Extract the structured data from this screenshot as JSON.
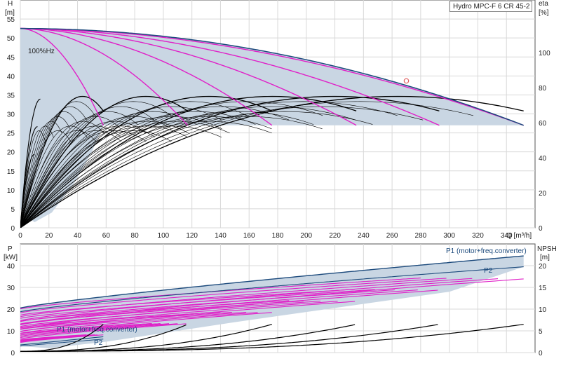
{
  "chart_data": [
    {
      "type": "line",
      "title": "Hydro MPC-F 6 CR 45-2",
      "xlabel": "Q [m³/h]",
      "ylabel_left": [
        "H",
        "[m]"
      ],
      "ylabel_right": [
        "eta",
        "[%]"
      ],
      "annotation": "100%Hz",
      "xlim": [
        0,
        360
      ],
      "x_ticks": [
        0,
        20,
        40,
        60,
        80,
        100,
        120,
        140,
        160,
        180,
        200,
        220,
        240,
        260,
        280,
        300,
        320,
        340
      ],
      "ylim_left": [
        0,
        60
      ],
      "y_ticks_left": [
        0,
        5,
        10,
        15,
        20,
        25,
        30,
        35,
        40,
        45,
        50,
        55
      ],
      "ylim_right": [
        0,
        130
      ],
      "y_ticks_right": [
        0,
        20,
        40,
        60,
        80,
        100
      ],
      "operating_range_shade": "#c9d6e3",
      "pump_curves_H": {
        "n_pumps": [
          1,
          2,
          3,
          4,
          5,
          6
        ],
        "qmax": [
          58,
          117,
          176,
          235,
          293,
          352
        ],
        "H0": 52.5,
        "Hend_100": 27,
        "min_head": 27,
        "color_100": "#1c4a7c",
        "color_reduced": "#e020c8"
      },
      "duty_point": {
        "x": 270,
        "y": 38.7,
        "color": "#e06060"
      },
      "efficiency_curves": {
        "color": "#000000",
        "peak_eta_full": 70,
        "best_eff_fraction": 0.6,
        "n_pumps": [
          1,
          2,
          3,
          4,
          5,
          6
        ]
      }
    },
    {
      "type": "line",
      "ylabel_left": [
        "P",
        "[kW]"
      ],
      "ylabel_right": [
        "NPSH",
        "[m]"
      ],
      "xlim": [
        0,
        360
      ],
      "ylim_left": [
        0,
        50
      ],
      "y_ticks_left": [
        0,
        10,
        20,
        30,
        40
      ],
      "ylim_right": [
        0,
        25
      ],
      "y_ticks_right": [
        0,
        5,
        10,
        15,
        20
      ],
      "labels": {
        "p1_top": "P1 (motor+freq.converter)",
        "p2_top": "P2",
        "p1_low": "P1 (motor+freq.converter)",
        "p2_low": "P2"
      },
      "power": {
        "p1_at_zero": 20.5,
        "p1_at_max": 44.5,
        "p2_at_max": 39.5,
        "p2_offset": 1.7,
        "color_100": "#1c4a7c",
        "color_reduced": "#e020c8"
      },
      "npsh": {
        "color": "#000000",
        "start": 0.3,
        "end": 6.5
      }
    }
  ]
}
